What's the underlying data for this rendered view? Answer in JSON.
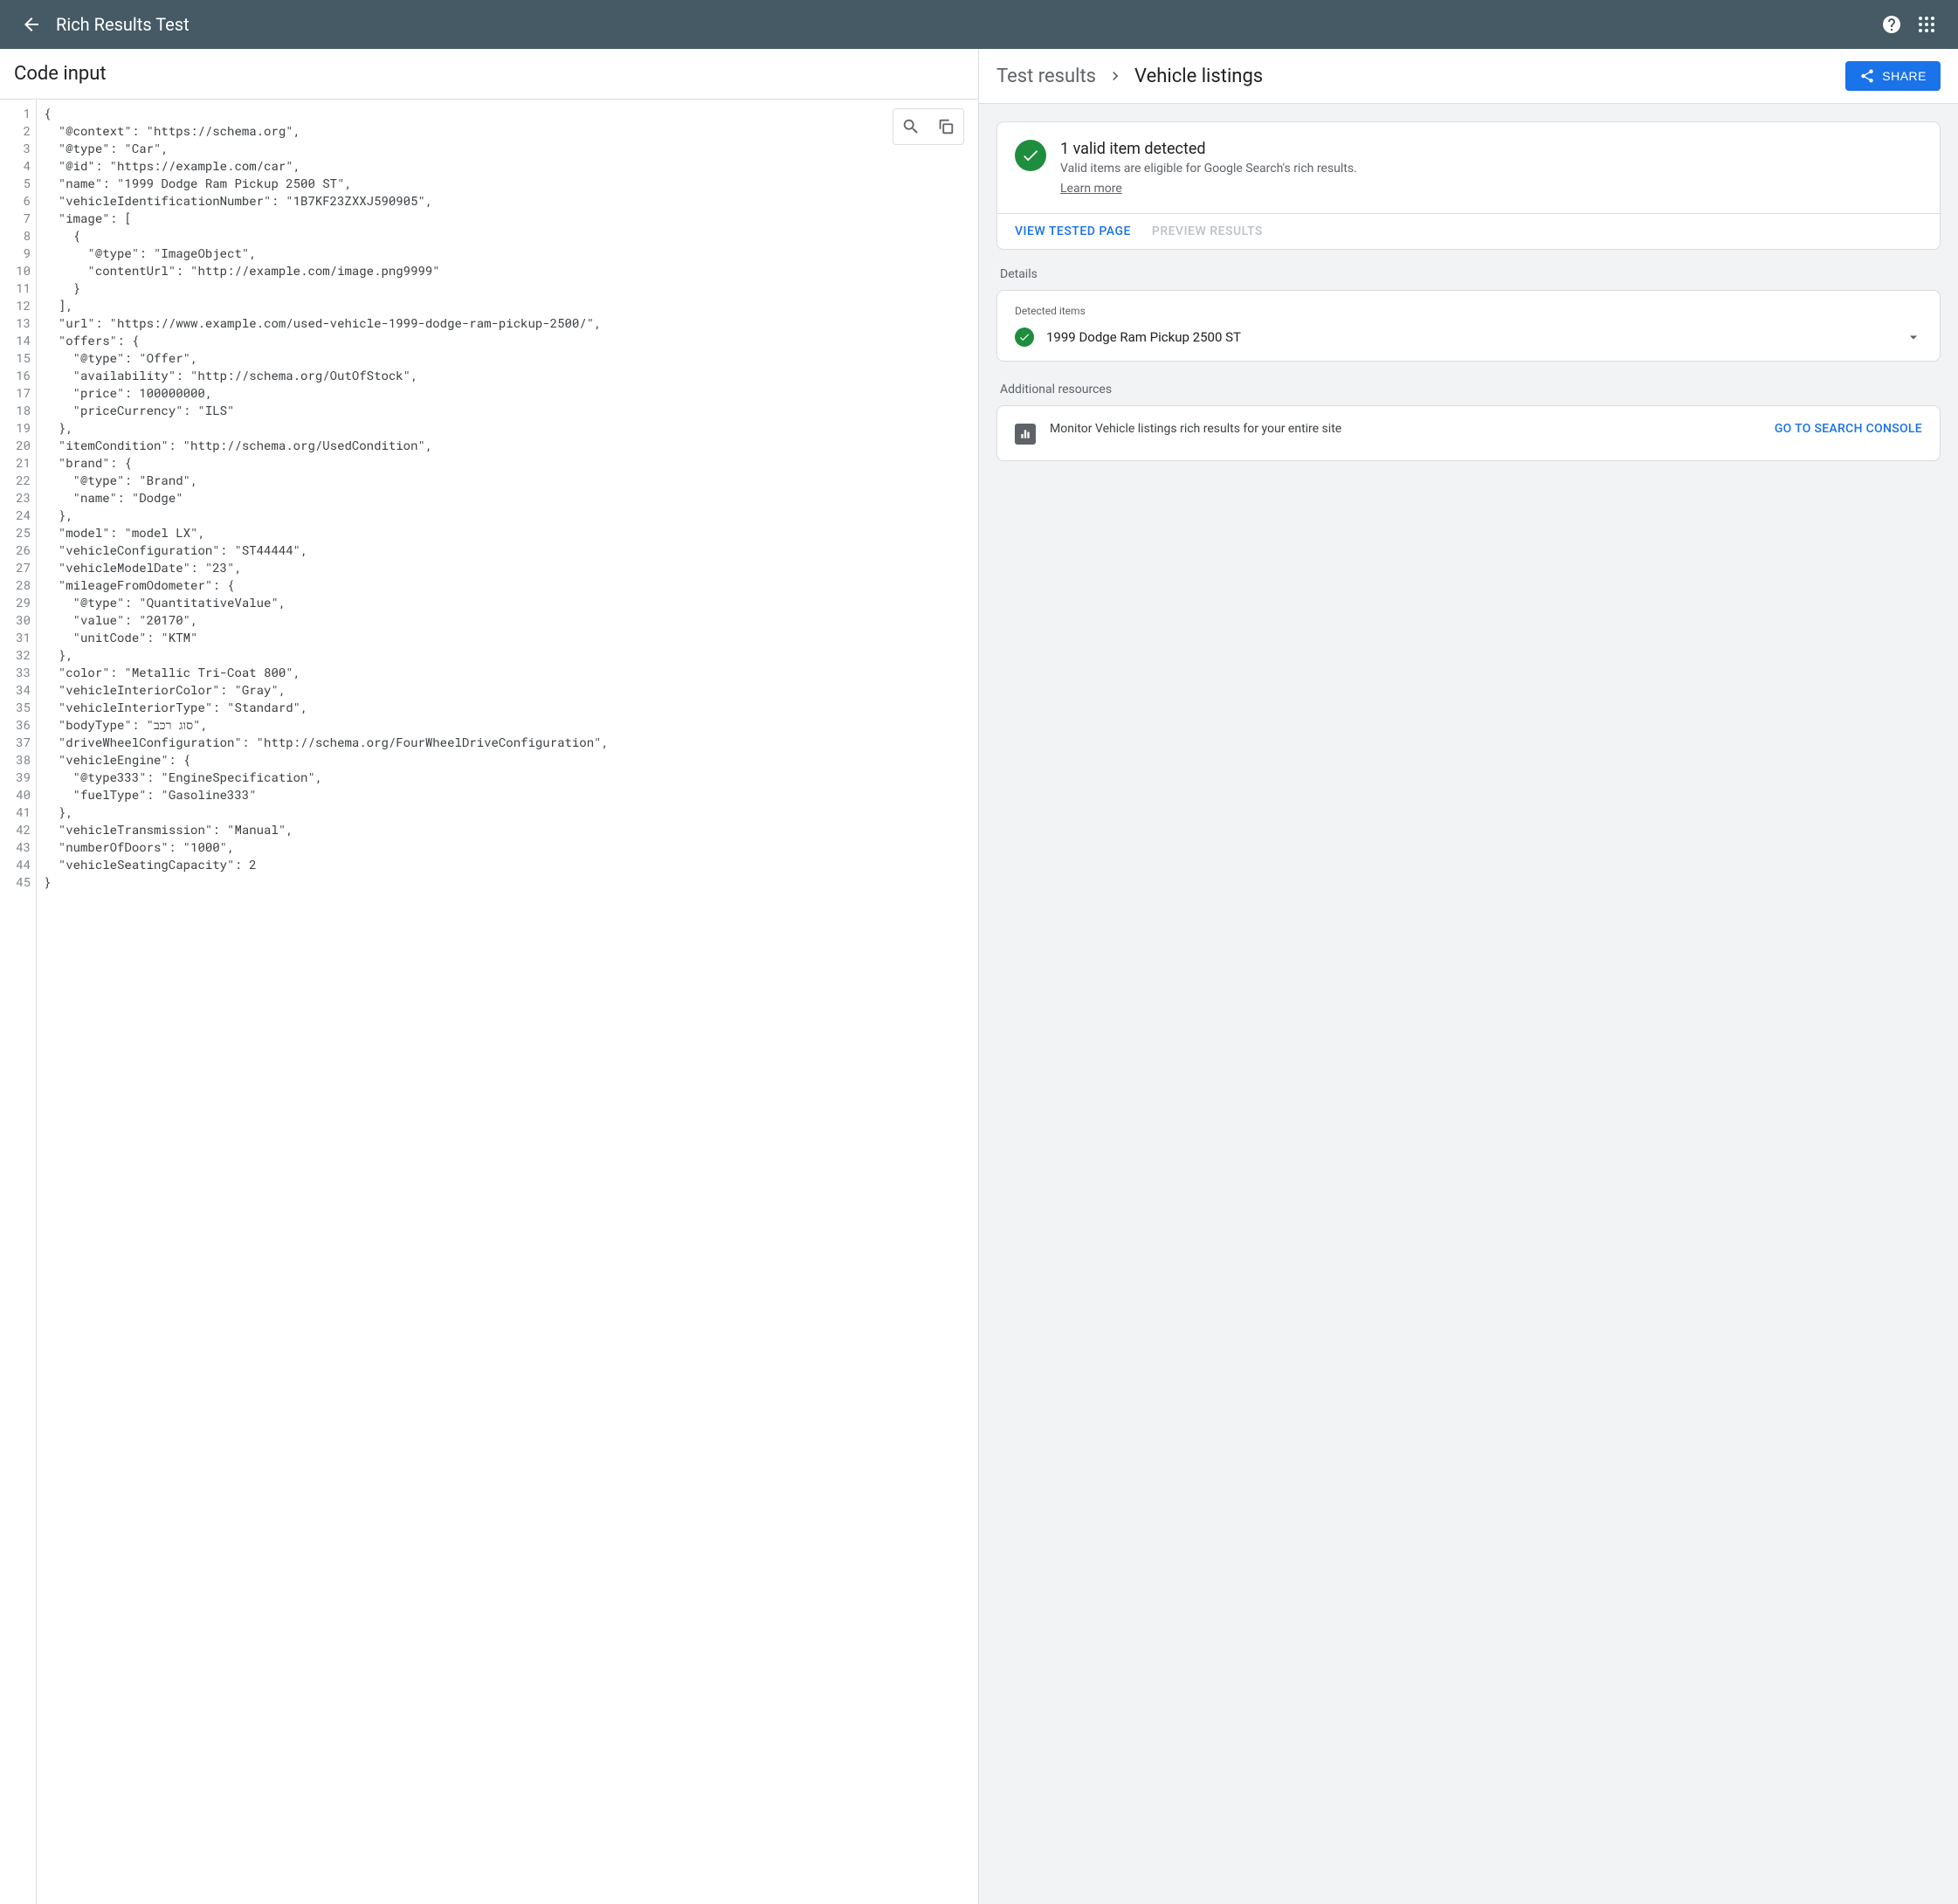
{
  "header": {
    "title": "Rich Results Test"
  },
  "left": {
    "title": "Code input",
    "lines": [
      "{",
      "  \"@context\": \"https://schema.org\",",
      "  \"@type\": \"Car\",",
      "  \"@id\": \"https://example.com/car\",",
      "  \"name\": \"1999 Dodge Ram Pickup 2500 ST\",",
      "  \"vehicleIdentificationNumber\": \"1B7KF23ZXXJ590905\",",
      "  \"image\": [",
      "    {",
      "      \"@type\": \"ImageObject\",",
      "      \"contentUrl\": \"http://example.com/image.png9999\"",
      "    }",
      "  ],",
      "  \"url\": \"https://www.example.com/used-vehicle-1999-dodge-ram-pickup-2500/\",",
      "  \"offers\": {",
      "    \"@type\": \"Offer\",",
      "    \"availability\": \"http://schema.org/OutOfStock\",",
      "    \"price\": 100000000,",
      "    \"priceCurrency\": \"ILS\"",
      "  },",
      "  \"itemCondition\": \"http://schema.org/UsedCondition\",",
      "  \"brand\": {",
      "    \"@type\": \"Brand\",",
      "    \"name\": \"Dodge\"",
      "  },",
      "  \"model\": \"model LX\",",
      "  \"vehicleConfiguration\": \"ST44444\",",
      "  \"vehicleModelDate\": \"23\",",
      "  \"mileageFromOdometer\": {",
      "    \"@type\": \"QuantitativeValue\",",
      "    \"value\": \"20170\",",
      "    \"unitCode\": \"KTM\"",
      "  },",
      "  \"color\": \"Metallic Tri-Coat 800\",",
      "  \"vehicleInteriorColor\": \"Gray\",",
      "  \"vehicleInteriorType\": \"Standard\",",
      "  \"bodyType\": \"סוג רכב\",",
      "  \"driveWheelConfiguration\": \"http://schema.org/FourWheelDriveConfiguration\",",
      "  \"vehicleEngine\": {",
      "    \"@type333\": \"EngineSpecification\",",
      "    \"fuelType\": \"Gasoline333\"",
      "  },",
      "  \"vehicleTransmission\": \"Manual\",",
      "  \"numberOfDoors\": \"1000\",",
      "  \"vehicleSeatingCapacity\": 2",
      "}"
    ]
  },
  "results": {
    "breadcrumb": {
      "a": "Test results",
      "b": "Vehicle listings"
    },
    "share": "SHARE",
    "status": {
      "headline": "1 valid item detected",
      "subtext": "Valid items are eligible for Google Search's rich results.",
      "learn": "Learn more"
    },
    "actions": {
      "view": "VIEW TESTED PAGE",
      "preview": "PREVIEW RESULTS"
    },
    "details_label": "Details",
    "detected_label": "Detected items",
    "detected_item": "1999 Dodge Ram Pickup 2500 ST",
    "additional_label": "Additional resources",
    "resource_text": "Monitor Vehicle listings rich results for your entire site",
    "resource_link": "GO TO SEARCH CONSOLE"
  }
}
